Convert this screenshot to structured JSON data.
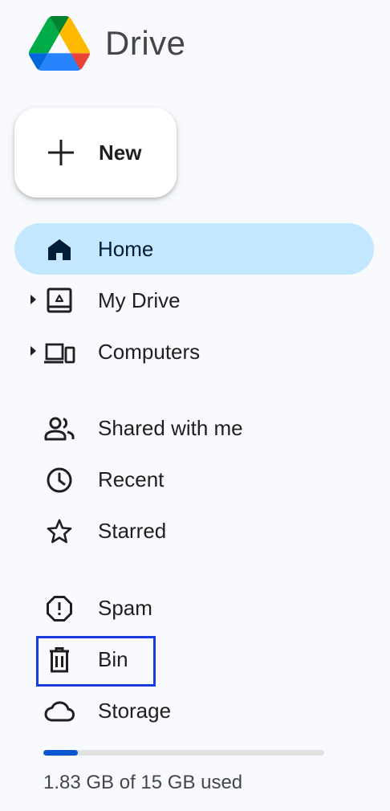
{
  "app": {
    "title": "Drive",
    "logo_icon": "google-drive-logo"
  },
  "new_button": {
    "label": "New",
    "icon": "plus-icon"
  },
  "nav": {
    "home": {
      "label": "Home",
      "icon": "home-icon",
      "active": true
    },
    "my_drive": {
      "label": "My Drive",
      "icon": "my-drive-icon",
      "expandable": true
    },
    "computers": {
      "label": "Computers",
      "icon": "computers-icon",
      "expandable": true
    },
    "shared": {
      "label": "Shared with me",
      "icon": "people-icon"
    },
    "recent": {
      "label": "Recent",
      "icon": "clock-icon"
    },
    "starred": {
      "label": "Starred",
      "icon": "star-icon"
    },
    "spam": {
      "label": "Spam",
      "icon": "spam-icon"
    },
    "bin": {
      "label": "Bin",
      "icon": "trash-icon",
      "highlighted": true
    },
    "storage": {
      "label": "Storage",
      "icon": "cloud-icon"
    }
  },
  "storage": {
    "used_text": "1.83 GB of 15 GB used",
    "used_fraction": 0.122
  },
  "colors": {
    "background": "#f8fafd",
    "active_item": "#c2e7ff",
    "storage_fill": "#0b57d0",
    "highlight_box": "#1a3bdf"
  }
}
